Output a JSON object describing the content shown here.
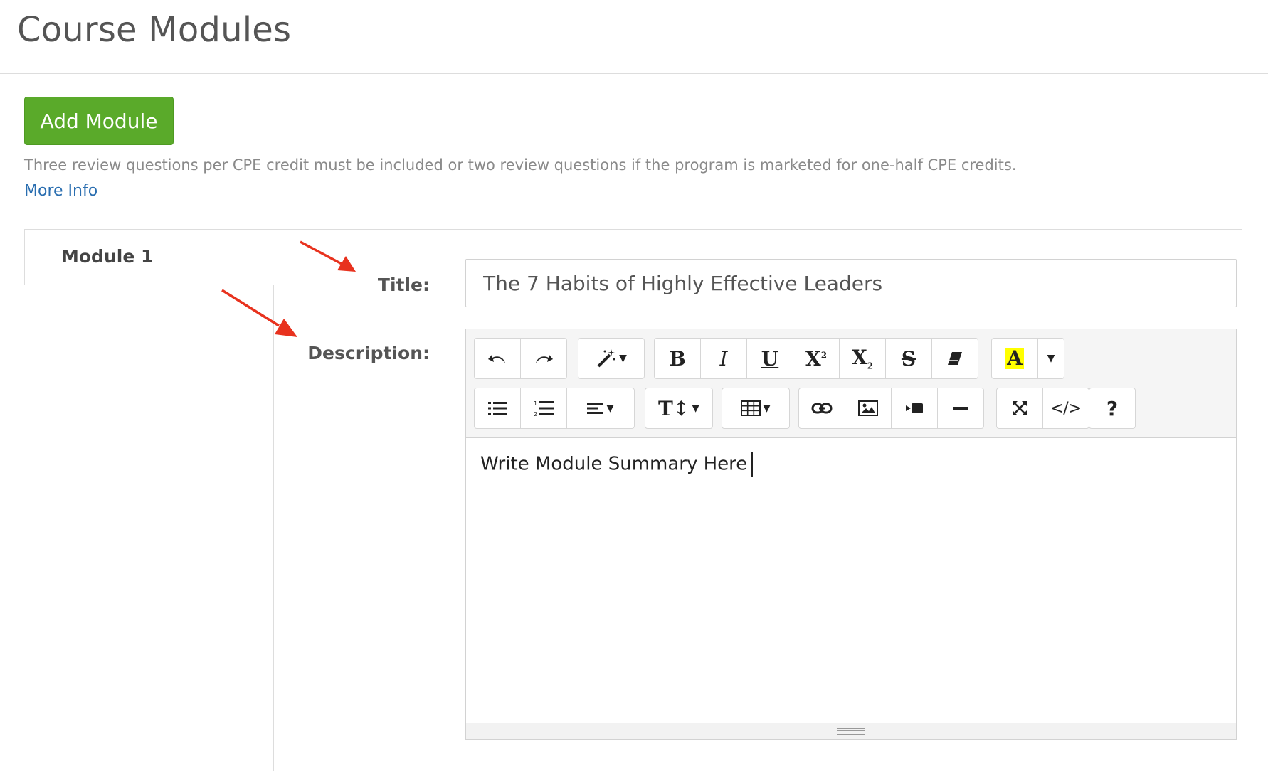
{
  "page": {
    "title": "Course Modules"
  },
  "actions": {
    "add_module_label": "Add Module"
  },
  "notice": {
    "text": "Three review questions per CPE credit must be included or two review questions if the program is marketed for one-half CPE credits.",
    "link_label": "More Info"
  },
  "tabs": [
    {
      "label": "Module 1"
    }
  ],
  "form": {
    "title_label": "Title:",
    "title_value": "The 7 Habits of Highly Effective Leaders",
    "description_label": "Description:",
    "description_text": "Write Module Summary Here"
  },
  "toolbar": {
    "row1": [
      "undo-icon",
      "redo-icon",
      "magic-wand-icon",
      "bold-icon",
      "italic-icon",
      "underline-icon",
      "superscript-icon",
      "subscript-icon",
      "strikethrough-icon",
      "eraser-icon",
      "text-color-icon",
      "dropdown-caret-icon"
    ],
    "row2": [
      "unordered-list-icon",
      "ordered-list-icon",
      "align-icon",
      "text-height-icon",
      "table-icon",
      "link-icon",
      "image-icon",
      "video-icon",
      "horizontal-rule-icon",
      "fullscreen-icon",
      "code-view-icon",
      "help-icon"
    ]
  },
  "colors": {
    "accent_green": "#5aaa2a",
    "link_blue": "#2a6eb0",
    "highlight_yellow": "#ffff00",
    "annotation_red": "#e8321e"
  }
}
